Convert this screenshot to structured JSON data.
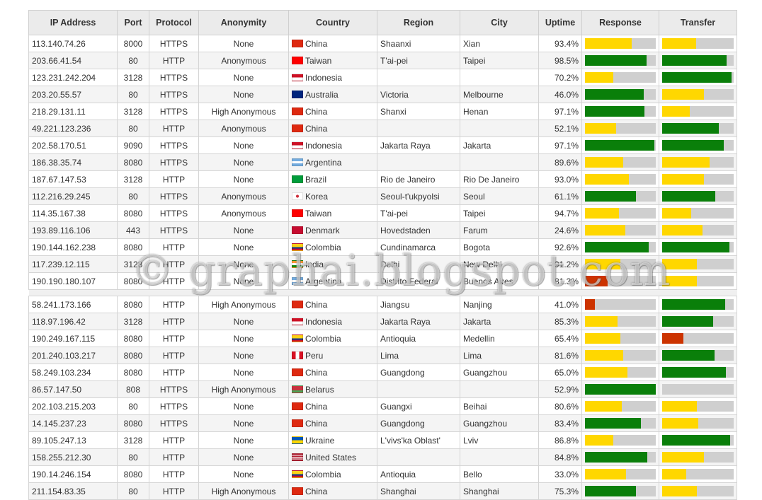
{
  "colors": {
    "green": "#0a7f0a",
    "yellow": "#ffd700",
    "red": "#cc3300",
    "empty": "#cfcfcf",
    "header_bg": "#ebebeb"
  },
  "flag_colors": {
    "China": "linear-gradient(#de2910,#de2910)",
    "Taiwan": "linear-gradient(to bottom,#fe0000 0%,#fe0000 100%)",
    "Indonesia": "linear-gradient(to bottom,#ce1126 0 50%,#ffffff 50% 100%)",
    "Australia": "linear-gradient(#00247d,#00247d)",
    "Argentina": "linear-gradient(to bottom,#74acdf 0 33%,#ffffff 33% 67%,#74acdf 67% 100%)",
    "Brazil": "linear-gradient(#009c3b,#009c3b)",
    "Korea": "radial-gradient(circle,#cd2e3a 0 25%,#ffffff 26% 100%)",
    "Denmark": "linear-gradient(#c60c30,#c60c30)",
    "Colombia": "linear-gradient(to bottom,#fcd116 0 50%,#003893 50% 75%,#ce1126 75% 100%)",
    "India": "linear-gradient(to bottom,#ff9933 0 33%,#ffffff 33% 67%,#138808 67% 100%)",
    "Peru": "linear-gradient(to right,#d91023 0 33%,#ffffff 33% 67%,#d91023 67% 100%)",
    "Belarus": "linear-gradient(to bottom,#c8313e 0 66%,#4aa657 66% 100%)",
    "Ukraine": "linear-gradient(to bottom,#0057b7 0 50%,#ffd700 50% 100%)",
    "United States": "linear-gradient(to bottom,#b22234 0 14%,#ffffff 14% 28%,#b22234 28% 42%,#ffffff 42% 56%,#b22234 56% 70%,#ffffff 70% 84%,#b22234 84% 100%)"
  },
  "headers": [
    "IP Address",
    "Port",
    "Protocol",
    "Anonymity",
    "Country",
    "Region",
    "City",
    "Uptime",
    "Response",
    "Transfer"
  ],
  "rows": [
    {
      "ip": "113.140.74.26",
      "port": "8000",
      "protocol": "HTTPS",
      "anonymity": "None",
      "country": "China",
      "region": "Shaanxi",
      "city": "Xian",
      "uptime": "93.4%",
      "response": {
        "level": 0.66,
        "color": "yellow"
      },
      "transfer": {
        "level": 0.48,
        "color": "yellow"
      }
    },
    {
      "ip": "203.66.41.54",
      "port": "80",
      "protocol": "HTTP",
      "anonymity": "Anonymous",
      "country": "Taiwan",
      "region": "T'ai-pei",
      "city": "Taipei",
      "uptime": "98.5%",
      "response": {
        "level": 0.87,
        "color": "green"
      },
      "transfer": {
        "level": 0.9,
        "color": "green"
      }
    },
    {
      "ip": "123.231.242.204",
      "port": "3128",
      "protocol": "HTTPS",
      "anonymity": "None",
      "country": "Indonesia",
      "region": "",
      "city": "",
      "uptime": "70.2%",
      "response": {
        "level": 0.4,
        "color": "yellow"
      },
      "transfer": {
        "level": 0.97,
        "color": "green"
      }
    },
    {
      "ip": "203.20.55.57",
      "port": "80",
      "protocol": "HTTPS",
      "anonymity": "None",
      "country": "Australia",
      "region": "Victoria",
      "city": "Melbourne",
      "uptime": "46.0%",
      "response": {
        "level": 0.83,
        "color": "green"
      },
      "transfer": {
        "level": 0.58,
        "color": "yellow"
      }
    },
    {
      "ip": "218.29.131.11",
      "port": "3128",
      "protocol": "HTTPS",
      "anonymity": "High Anonymous",
      "country": "China",
      "region": "Shanxi",
      "city": "Henan",
      "uptime": "97.1%",
      "response": {
        "level": 0.84,
        "color": "green"
      },
      "transfer": {
        "level": 0.39,
        "color": "yellow"
      }
    },
    {
      "ip": "49.221.123.236",
      "port": "80",
      "protocol": "HTTP",
      "anonymity": "Anonymous",
      "country": "China",
      "region": "",
      "city": "",
      "uptime": "52.1%",
      "response": {
        "level": 0.44,
        "color": "yellow"
      },
      "transfer": {
        "level": 0.79,
        "color": "green"
      }
    },
    {
      "ip": "202.58.170.51",
      "port": "9090",
      "protocol": "HTTPS",
      "anonymity": "None",
      "country": "Indonesia",
      "region": "Jakarta Raya",
      "city": "Jakarta",
      "uptime": "97.1%",
      "response": {
        "level": 0.98,
        "color": "green"
      },
      "transfer": {
        "level": 0.86,
        "color": "green"
      }
    },
    {
      "ip": "186.38.35.74",
      "port": "8080",
      "protocol": "HTTPS",
      "anonymity": "None",
      "country": "Argentina",
      "region": "",
      "city": "",
      "uptime": "89.6%",
      "response": {
        "level": 0.54,
        "color": "yellow"
      },
      "transfer": {
        "level": 0.66,
        "color": "yellow"
      }
    },
    {
      "ip": "187.67.147.53",
      "port": "3128",
      "protocol": "HTTP",
      "anonymity": "None",
      "country": "Brazil",
      "region": "Rio de Janeiro",
      "city": "Rio De Janeiro",
      "uptime": "93.0%",
      "response": {
        "level": 0.62,
        "color": "yellow"
      },
      "transfer": {
        "level": 0.58,
        "color": "yellow"
      }
    },
    {
      "ip": "112.216.29.245",
      "port": "80",
      "protocol": "HTTPS",
      "anonymity": "Anonymous",
      "country": "Korea",
      "region": "Seoul-t'ukpyolsi",
      "city": "Seoul",
      "uptime": "61.1%",
      "response": {
        "level": 0.72,
        "color": "green"
      },
      "transfer": {
        "level": 0.74,
        "color": "green"
      }
    },
    {
      "ip": "114.35.167.38",
      "port": "8080",
      "protocol": "HTTPS",
      "anonymity": "Anonymous",
      "country": "Taiwan",
      "region": "T'ai-pei",
      "city": "Taipei",
      "uptime": "94.7%",
      "response": {
        "level": 0.48,
        "color": "yellow"
      },
      "transfer": {
        "level": 0.41,
        "color": "yellow"
      }
    },
    {
      "ip": "193.89.116.106",
      "port": "443",
      "protocol": "HTTPS",
      "anonymity": "None",
      "country": "Denmark",
      "region": "Hovedstaden",
      "city": "Farum",
      "uptime": "24.6%",
      "response": {
        "level": 0.57,
        "color": "yellow"
      },
      "transfer": {
        "level": 0.56,
        "color": "yellow"
      }
    },
    {
      "ip": "190.144.162.238",
      "port": "8080",
      "protocol": "HTTP",
      "anonymity": "None",
      "country": "Colombia",
      "region": "Cundinamarca",
      "city": "Bogota",
      "uptime": "92.6%",
      "response": {
        "level": 0.9,
        "color": "green"
      },
      "transfer": {
        "level": 0.94,
        "color": "green"
      }
    },
    {
      "ip": "117.239.12.115",
      "port": "3128",
      "protocol": "HTTP",
      "anonymity": "None",
      "country": "India",
      "region": "Delhi",
      "city": "New Delhi",
      "uptime": "91.2%",
      "response": {
        "level": 0.5,
        "color": "yellow"
      },
      "transfer": {
        "level": 0.49,
        "color": "yellow"
      }
    },
    {
      "ip": "190.190.180.107",
      "port": "8080",
      "protocol": "HTTP",
      "anonymity": "None",
      "country": "Argentina",
      "region": "Distrito Federal",
      "city": "Buenos Aires",
      "uptime": "81.3%",
      "response": {
        "level": 0.32,
        "color": "red"
      },
      "transfer": {
        "level": 0.49,
        "color": "yellow"
      }
    },
    {
      "ip": "58.241.173.166",
      "port": "8080",
      "protocol": "HTTP",
      "anonymity": "High Anonymous",
      "country": "China",
      "region": "Jiangsu",
      "city": "Nanjing",
      "uptime": "41.0%",
      "response": {
        "level": 0.14,
        "color": "red"
      },
      "transfer": {
        "level": 0.88,
        "color": "green"
      }
    },
    {
      "ip": "118.97.196.42",
      "port": "3128",
      "protocol": "HTTP",
      "anonymity": "None",
      "country": "Indonesia",
      "region": "Jakarta Raya",
      "city": "Jakarta",
      "uptime": "85.3%",
      "response": {
        "level": 0.46,
        "color": "yellow"
      },
      "transfer": {
        "level": 0.71,
        "color": "green"
      }
    },
    {
      "ip": "190.249.167.115",
      "port": "8080",
      "protocol": "HTTP",
      "anonymity": "None",
      "country": "Colombia",
      "region": "Antioquia",
      "city": "Medellin",
      "uptime": "65.4%",
      "response": {
        "level": 0.5,
        "color": "yellow"
      },
      "transfer": {
        "level": 0.3,
        "color": "red"
      }
    },
    {
      "ip": "201.240.103.217",
      "port": "8080",
      "protocol": "HTTP",
      "anonymity": "None",
      "country": "Peru",
      "region": "Lima",
      "city": "Lima",
      "uptime": "81.6%",
      "response": {
        "level": 0.54,
        "color": "yellow"
      },
      "transfer": {
        "level": 0.73,
        "color": "green"
      }
    },
    {
      "ip": "58.249.103.234",
      "port": "8080",
      "protocol": "HTTP",
      "anonymity": "None",
      "country": "China",
      "region": "Guangdong",
      "city": "Guangzhou",
      "uptime": "65.0%",
      "response": {
        "level": 0.6,
        "color": "yellow"
      },
      "transfer": {
        "level": 0.89,
        "color": "green"
      }
    },
    {
      "ip": "86.57.147.50",
      "port": "808",
      "protocol": "HTTPS",
      "anonymity": "High Anonymous",
      "country": "Belarus",
      "region": "",
      "city": "",
      "uptime": "52.9%",
      "response": {
        "level": 1.0,
        "color": "green"
      },
      "transfer": {
        "level": 0.0,
        "color": "yellow"
      }
    },
    {
      "ip": "202.103.215.203",
      "port": "80",
      "protocol": "HTTPS",
      "anonymity": "None",
      "country": "China",
      "region": "Guangxi",
      "city": "Beihai",
      "uptime": "80.6%",
      "response": {
        "level": 0.52,
        "color": "yellow"
      },
      "transfer": {
        "level": 0.49,
        "color": "yellow"
      }
    },
    {
      "ip": "14.145.237.23",
      "port": "8080",
      "protocol": "HTTPS",
      "anonymity": "None",
      "country": "China",
      "region": "Guangdong",
      "city": "Guangzhou",
      "uptime": "83.4%",
      "response": {
        "level": 0.79,
        "color": "green"
      },
      "transfer": {
        "level": 0.5,
        "color": "yellow"
      }
    },
    {
      "ip": "89.105.247.13",
      "port": "3128",
      "protocol": "HTTP",
      "anonymity": "None",
      "country": "Ukraine",
      "region": "L'vivs'ka Oblast'",
      "city": "Lviv",
      "uptime": "86.8%",
      "response": {
        "level": 0.4,
        "color": "yellow"
      },
      "transfer": {
        "level": 0.95,
        "color": "green"
      }
    },
    {
      "ip": "158.255.212.30",
      "port": "80",
      "protocol": "HTTP",
      "anonymity": "None",
      "country": "United States",
      "region": "",
      "city": "",
      "uptime": "84.8%",
      "response": {
        "level": 0.88,
        "color": "green"
      },
      "transfer": {
        "level": 0.58,
        "color": "yellow"
      }
    },
    {
      "ip": "190.14.246.154",
      "port": "8080",
      "protocol": "HTTP",
      "anonymity": "None",
      "country": "Colombia",
      "region": "Antioquia",
      "city": "Bello",
      "uptime": "33.0%",
      "response": {
        "level": 0.58,
        "color": "yellow"
      },
      "transfer": {
        "level": 0.34,
        "color": "yellow"
      }
    },
    {
      "ip": "211.154.83.35",
      "port": "80",
      "protocol": "HTTP",
      "anonymity": "High Anonymous",
      "country": "China",
      "region": "Shanghai",
      "city": "Shanghai",
      "uptime": "75.3%",
      "response": {
        "level": 0.72,
        "color": "green"
      },
      "transfer": {
        "level": 0.49,
        "color": "yellow"
      }
    }
  ],
  "watermark": "© graphai.blogspot.com"
}
